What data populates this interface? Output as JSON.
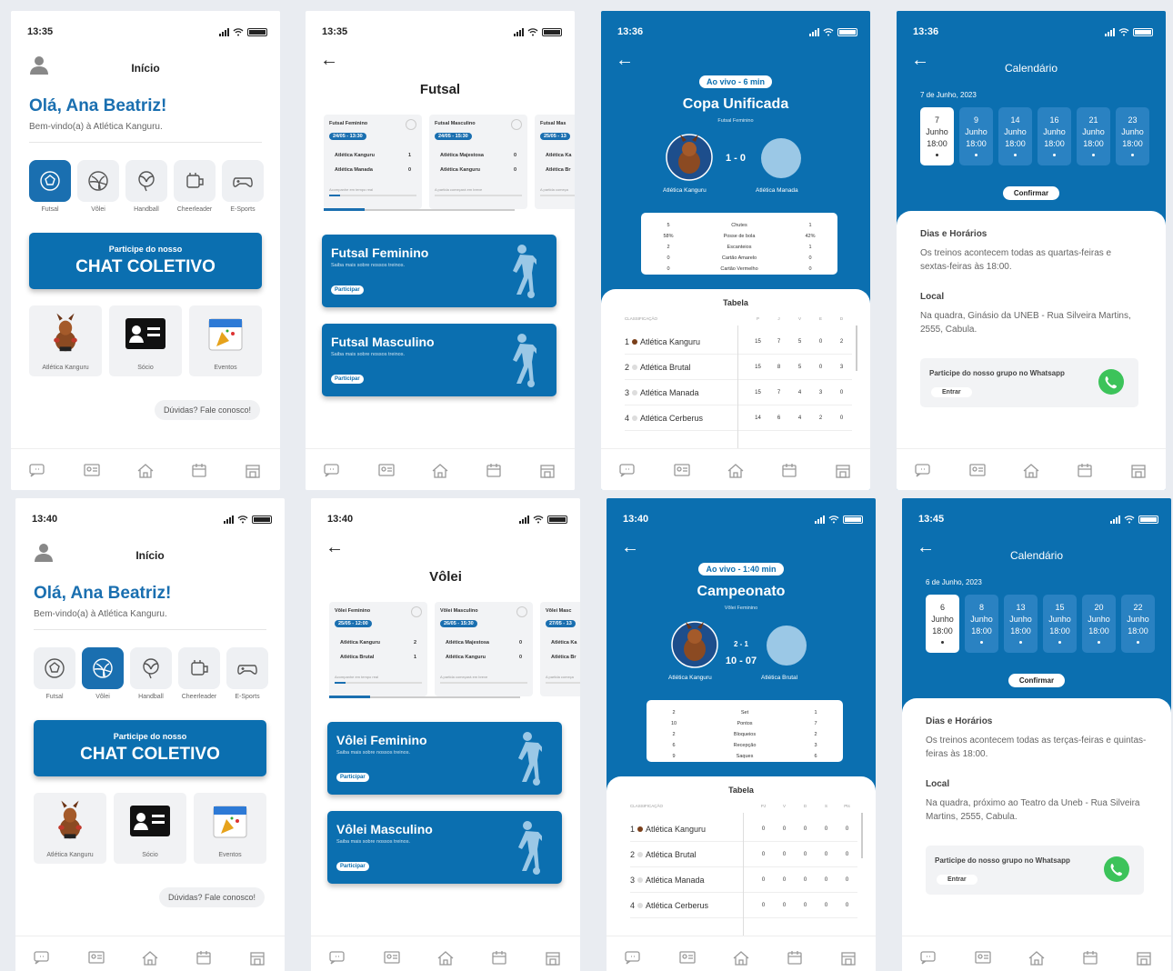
{
  "screens": [
    {
      "id": "home1",
      "time": "13:35",
      "title": "Início",
      "greeting": "Olá, Ana Beatriz!",
      "welcome": "Bem-vindo(a) à Atlética Kanguru.",
      "sports": [
        "Futsal",
        "Vôlei",
        "Handball",
        "Cheerleader",
        "E-Sports"
      ],
      "active_sport": 0,
      "chat_line1": "Participe do nosso",
      "chat_line2": "CHAT COLETIVO",
      "tiles": [
        "Atlética Kanguru",
        "Sócio",
        "Eventos"
      ],
      "help": "Dúvidas? Fale conosco!"
    },
    {
      "id": "sport1",
      "time": "13:35",
      "title": "Futsal",
      "games": [
        {
          "title": "Futsal Feminino",
          "date": "24/05 - 13:30",
          "t1": "Atlética Kanguru",
          "s1": "1",
          "t2": "Atlética Manada",
          "s2": "0",
          "foot": "Acompanhe em tempo real"
        },
        {
          "title": "Futsal Masculino",
          "date": "24/05 - 15:30",
          "t1": "Atlética Majestosa",
          "s1": "0",
          "t2": "Atlética Kanguru",
          "s2": "0",
          "foot": "A partida começará em breve"
        },
        {
          "title": "Futsal Mas",
          "date": "25/05 - 13",
          "t1": "Atlética Ka",
          "s1": "",
          "t2": "Atlética Br",
          "s2": "",
          "foot": "A partida começa"
        }
      ],
      "teams": [
        {
          "title": "Futsal Feminino",
          "sub": "Saiba mais sobre nossos treinos.",
          "btn": "Participar"
        },
        {
          "title": "Futsal Masculino",
          "sub": "Saiba mais sobre nossos treinos.",
          "btn": "Participar"
        }
      ]
    },
    {
      "id": "live1",
      "time": "13:36",
      "live": "Ao vivo - 6 min",
      "comp": "Copa Unificada",
      "cat": "Futsal Feminino",
      "score": "1 - 0",
      "team1": "Atlética Kanguru",
      "team2": "Atlética Manada",
      "stats": [
        [
          "5",
          "Chutes",
          "1"
        ],
        [
          "58%",
          "Posse de bola",
          "42%"
        ],
        [
          "2",
          "Escanteios",
          "1"
        ],
        [
          "0",
          "Cartão Amarelo",
          "0"
        ],
        [
          "0",
          "Cartão Vermelho",
          "0"
        ]
      ],
      "table_title": "Tabela",
      "table_head": [
        "CLASSIFICAÇÃO",
        "P",
        "J",
        "V",
        "E",
        "D"
      ],
      "rows": [
        [
          "1",
          "Atlética Kanguru",
          "15",
          "7",
          "5",
          "0",
          "2"
        ],
        [
          "2",
          "Atlética Brutal",
          "15",
          "8",
          "5",
          "0",
          "3"
        ],
        [
          "3",
          "Atlética Manada",
          "15",
          "7",
          "4",
          "3",
          "0"
        ],
        [
          "4",
          "Atlética Cerberus",
          "14",
          "6",
          "4",
          "2",
          "0"
        ]
      ]
    },
    {
      "id": "cal1",
      "time": "13:36",
      "title": "Calendário",
      "date": "7 de Junho, 2023",
      "days": [
        [
          "7",
          "Junho",
          "18:00"
        ],
        [
          "9",
          "Junho",
          "18:00"
        ],
        [
          "14",
          "Junho",
          "18:00"
        ],
        [
          "16",
          "Junho",
          "18:00"
        ],
        [
          "21",
          "Junho",
          "18:00"
        ],
        [
          "23",
          "Junho",
          "18:00"
        ]
      ],
      "confirm": "Confirmar",
      "h1": "Dias e Horários",
      "p1": "Os treinos acontecem todas as quartas-feiras e sextas-feiras às 18:00.",
      "h2": "Local",
      "p2": "Na quadra, Ginásio da UNEB - Rua Silveira Martins, 2555, Cabula.",
      "wa": "Participe do nosso grupo no Whatsapp",
      "wa_btn": "Entrar"
    },
    {
      "id": "home2",
      "time": "13:40",
      "title": "Início",
      "greeting": "Olá, Ana Beatriz!",
      "welcome": "Bem-vindo(a) à Atlética Kanguru.",
      "sports": [
        "Futsal",
        "Vôlei",
        "Handball",
        "Cheerleader",
        "E-Sports"
      ],
      "active_sport": 1,
      "chat_line1": "Participe do nosso",
      "chat_line2": "CHAT COLETIVO",
      "tiles": [
        "Atlética Kanguru",
        "Sócio",
        "Eventos"
      ],
      "help": "Dúvidas? Fale conosco!"
    },
    {
      "id": "sport2",
      "time": "13:40",
      "title": "Vôlei",
      "games": [
        {
          "title": "Vôlei Feminino",
          "date": "25/05 - 12:00",
          "t1": "Atlética Kanguru",
          "s1": "2",
          "t2": "Atlética Brutal",
          "s2": "1",
          "foot": "Acompanhe em tempo real"
        },
        {
          "title": "Vôlei Masculino",
          "date": "26/05 - 15:30",
          "t1": "Atlética Majestosa",
          "s1": "0",
          "t2": "Atlética Kanguru",
          "s2": "0",
          "foot": "A partida começará em breve"
        },
        {
          "title": "Vôlei Masc",
          "date": "27/05 - 13",
          "t1": "Atlética Ka",
          "s1": "",
          "t2": "Atlética Br",
          "s2": "",
          "foot": "A partida começa"
        }
      ],
      "teams": [
        {
          "title": "Vôlei Feminino",
          "sub": "Saiba mais sobre nossos treinos.",
          "btn": "Participar"
        },
        {
          "title": "Vôlei Masculino",
          "sub": "Saiba mais sobre nossos treinos.",
          "btn": "Participar"
        }
      ]
    },
    {
      "id": "live2",
      "time": "13:40",
      "live": "Ao vivo - 1:40 min",
      "comp": "Campeonato",
      "cat": "Vôlei Feminino",
      "score": "2 - 1",
      "score2": "10  -  07",
      "team1": "Atlética Kanguru",
      "team2": "Atlética Brutal",
      "stats": [
        [
          "2",
          "Set",
          "1"
        ],
        [
          "10",
          "Pontos",
          "7"
        ],
        [
          "2",
          "Bloqueios",
          "2"
        ],
        [
          "6",
          "Recepção",
          "3"
        ],
        [
          "9",
          "Saques",
          "6"
        ]
      ],
      "table_title": "Tabela",
      "table_head": [
        "CLASSIFICAÇÃO",
        "PJ",
        "V",
        "D",
        "S",
        "Pts"
      ],
      "rows": [
        [
          "1",
          "Atlética Kanguru",
          "0",
          "0",
          "0",
          "0",
          "0"
        ],
        [
          "2",
          "Atlética Brutal",
          "0",
          "0",
          "0",
          "0",
          "0"
        ],
        [
          "3",
          "Atlética Manada",
          "0",
          "0",
          "0",
          "0",
          "0"
        ],
        [
          "4",
          "Atlética Cerberus",
          "0",
          "0",
          "0",
          "0",
          "0"
        ]
      ]
    },
    {
      "id": "cal2",
      "time": "13:45",
      "title": "Calendário",
      "date": "6 de Junho, 2023",
      "days": [
        [
          "6",
          "Junho",
          "18:00"
        ],
        [
          "8",
          "Junho",
          "18:00"
        ],
        [
          "13",
          "Junho",
          "18:00"
        ],
        [
          "15",
          "Junho",
          "18:00"
        ],
        [
          "20",
          "Junho",
          "18:00"
        ],
        [
          "22",
          "Junho",
          "18:00"
        ]
      ],
      "confirm": "Confirmar",
      "h1": "Dias e Horários",
      "p1": "Os treinos acontecem todas as terças-feiras e quintas-feiras às 18:00.",
      "h2": "Local",
      "p2": "Na quadra, próximo ao Teatro da Uneb - Rua Silveira Martins, 2555, Cabula.",
      "wa": "Participe do nosso grupo no Whatsapp",
      "wa_btn": "Entrar"
    }
  ],
  "nav_icons": [
    "chat-icon",
    "id-card-icon",
    "home-icon",
    "calendar-icon",
    "store-icon"
  ],
  "colors": {
    "primary": "#0b6fb0",
    "whatsapp": "#3cc35a",
    "opponent": "#9bc8e6"
  }
}
